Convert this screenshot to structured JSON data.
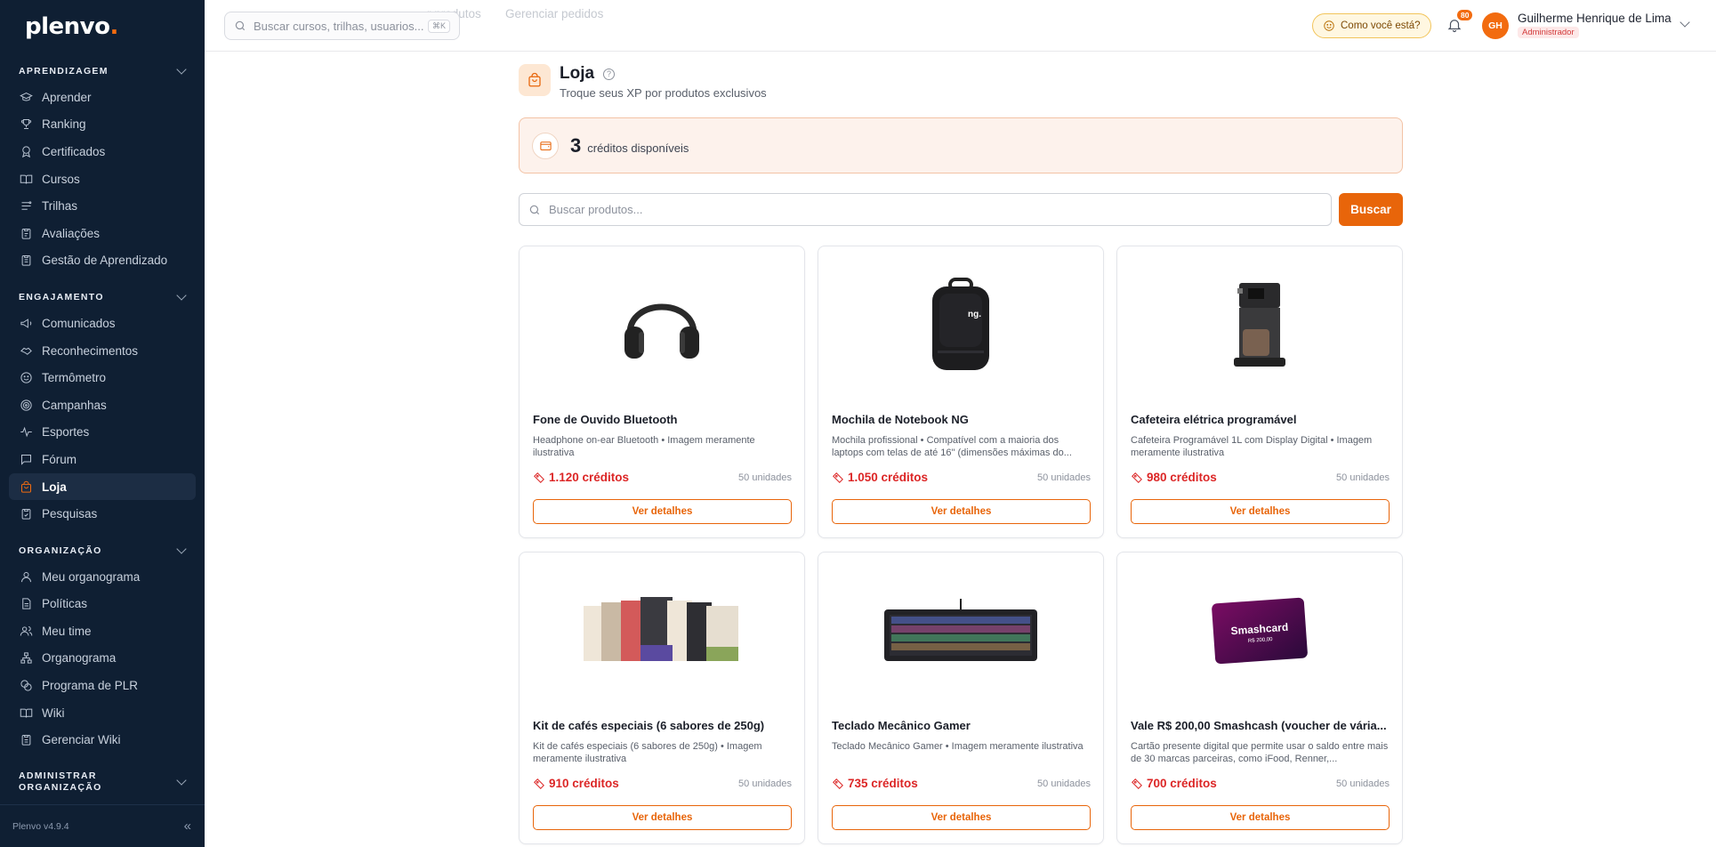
{
  "app": {
    "logo_text": "plenvo",
    "logo_dot": ".",
    "version": "Plenvo v4.9.4",
    "accent": "#f26b0f"
  },
  "sidebar": {
    "sections": [
      {
        "title": "APRENDIZAGEM",
        "items": [
          {
            "label": "Aprender",
            "icon": "graduation-cap-icon"
          },
          {
            "label": "Ranking",
            "icon": "trophy-icon"
          },
          {
            "label": "Certificados",
            "icon": "award-icon"
          },
          {
            "label": "Cursos",
            "icon": "book-open-icon"
          },
          {
            "label": "Trilhas",
            "icon": "route-icon"
          },
          {
            "label": "Avaliações",
            "icon": "clipboard-icon"
          },
          {
            "label": "Gestão de Aprendizado",
            "icon": "clipboard-list-icon"
          }
        ]
      },
      {
        "title": "ENGAJAMENTO",
        "items": [
          {
            "label": "Comunicados",
            "icon": "megaphone-icon"
          },
          {
            "label": "Reconhecimentos",
            "icon": "handshake-icon"
          },
          {
            "label": "Termômetro",
            "icon": "smile-icon"
          },
          {
            "label": "Campanhas",
            "icon": "target-icon"
          },
          {
            "label": "Esportes",
            "icon": "activity-icon"
          },
          {
            "label": "Fórum",
            "icon": "message-square-icon"
          },
          {
            "label": "Loja",
            "icon": "shopping-bag-icon",
            "active": true
          },
          {
            "label": "Pesquisas",
            "icon": "clipboard-check-icon"
          }
        ]
      },
      {
        "title": "ORGANIZAÇÃO",
        "items": [
          {
            "label": "Meu organograma",
            "icon": "user-icon"
          },
          {
            "label": "Políticas",
            "icon": "file-text-icon"
          },
          {
            "label": "Meu time",
            "icon": "users-icon"
          },
          {
            "label": "Organograma",
            "icon": "network-icon"
          },
          {
            "label": "Programa de PLR",
            "icon": "coins-icon"
          },
          {
            "label": "Wiki",
            "icon": "book-icon"
          },
          {
            "label": "Gerenciar Wiki",
            "icon": "clipboard-edit-icon"
          }
        ]
      },
      {
        "title_line1": "ADMINISTRAR",
        "title_line2": "ORGANIZAÇÃO"
      }
    ]
  },
  "topbar": {
    "search_placeholder": "Buscar cursos, trilhas, usuarios...",
    "search_shortcut": "⌘K",
    "ghost_tab_1": "r produtos",
    "ghost_tab_2": "Gerenciar pedidos",
    "mood_label": "Como você está?",
    "notification_count": "80",
    "user_initials": "GH",
    "user_name": "Guilherme Henrique de Lima",
    "user_role": "Administrador"
  },
  "page": {
    "title": "Loja",
    "help_glyph": "?",
    "subtitle": "Troque seus XP por produtos exclusivos",
    "credits_value": "3",
    "credits_label": "créditos disponíveis",
    "search_placeholder": "Buscar produtos...",
    "search_button": "Buscar"
  },
  "products": [
    {
      "title": "Fone de Ouvido Bluetooth",
      "desc": "Headphone on-ear Bluetooth • Imagem meramente ilustrativa",
      "price": "1.120 créditos",
      "units": "50 unidades",
      "button": "Ver detalhes",
      "image": "headphones"
    },
    {
      "title": "Mochila de Notebook NG",
      "desc": "Mochila profissional • Compatível com a maioria dos laptops com telas de até 16\" (dimensões máximas do...",
      "price": "1.050 créditos",
      "units": "50 unidades",
      "button": "Ver detalhes",
      "image": "backpack",
      "image_text": "ng."
    },
    {
      "title": "Cafeteira elétrica programável",
      "desc": "Cafeteira Programável 1L com Display Digital • Imagem meramente ilustrativa",
      "price": "980 créditos",
      "units": "50 unidades",
      "button": "Ver detalhes",
      "image": "coffee-maker"
    },
    {
      "title": "Kit de cafés especiais (6 sabores de 250g)",
      "desc": "Kit de cafés especiais (6 sabores de 250g) • Imagem meramente ilustrativa",
      "price": "910 créditos",
      "units": "50 unidades",
      "button": "Ver detalhes",
      "image": "coffee-bags"
    },
    {
      "title": "Teclado Mecânico Gamer",
      "desc": "Teclado Mecânico Gamer • Imagem meramente ilustrativa",
      "price": "735 créditos",
      "units": "50 unidades",
      "button": "Ver detalhes",
      "image": "keyboard"
    },
    {
      "title": "Vale R$ 200,00 Smashcash (voucher de vária...",
      "desc": "Cartão presente digital que permite usar o saldo entre mais de 30 marcas parceiras, como iFood, Renner,...",
      "price": "700 créditos",
      "units": "50 unidades",
      "button": "Ver detalhes",
      "image": "gift-card",
      "image_text": "Smashcard",
      "image_subtext": "R$ 200,00"
    }
  ]
}
